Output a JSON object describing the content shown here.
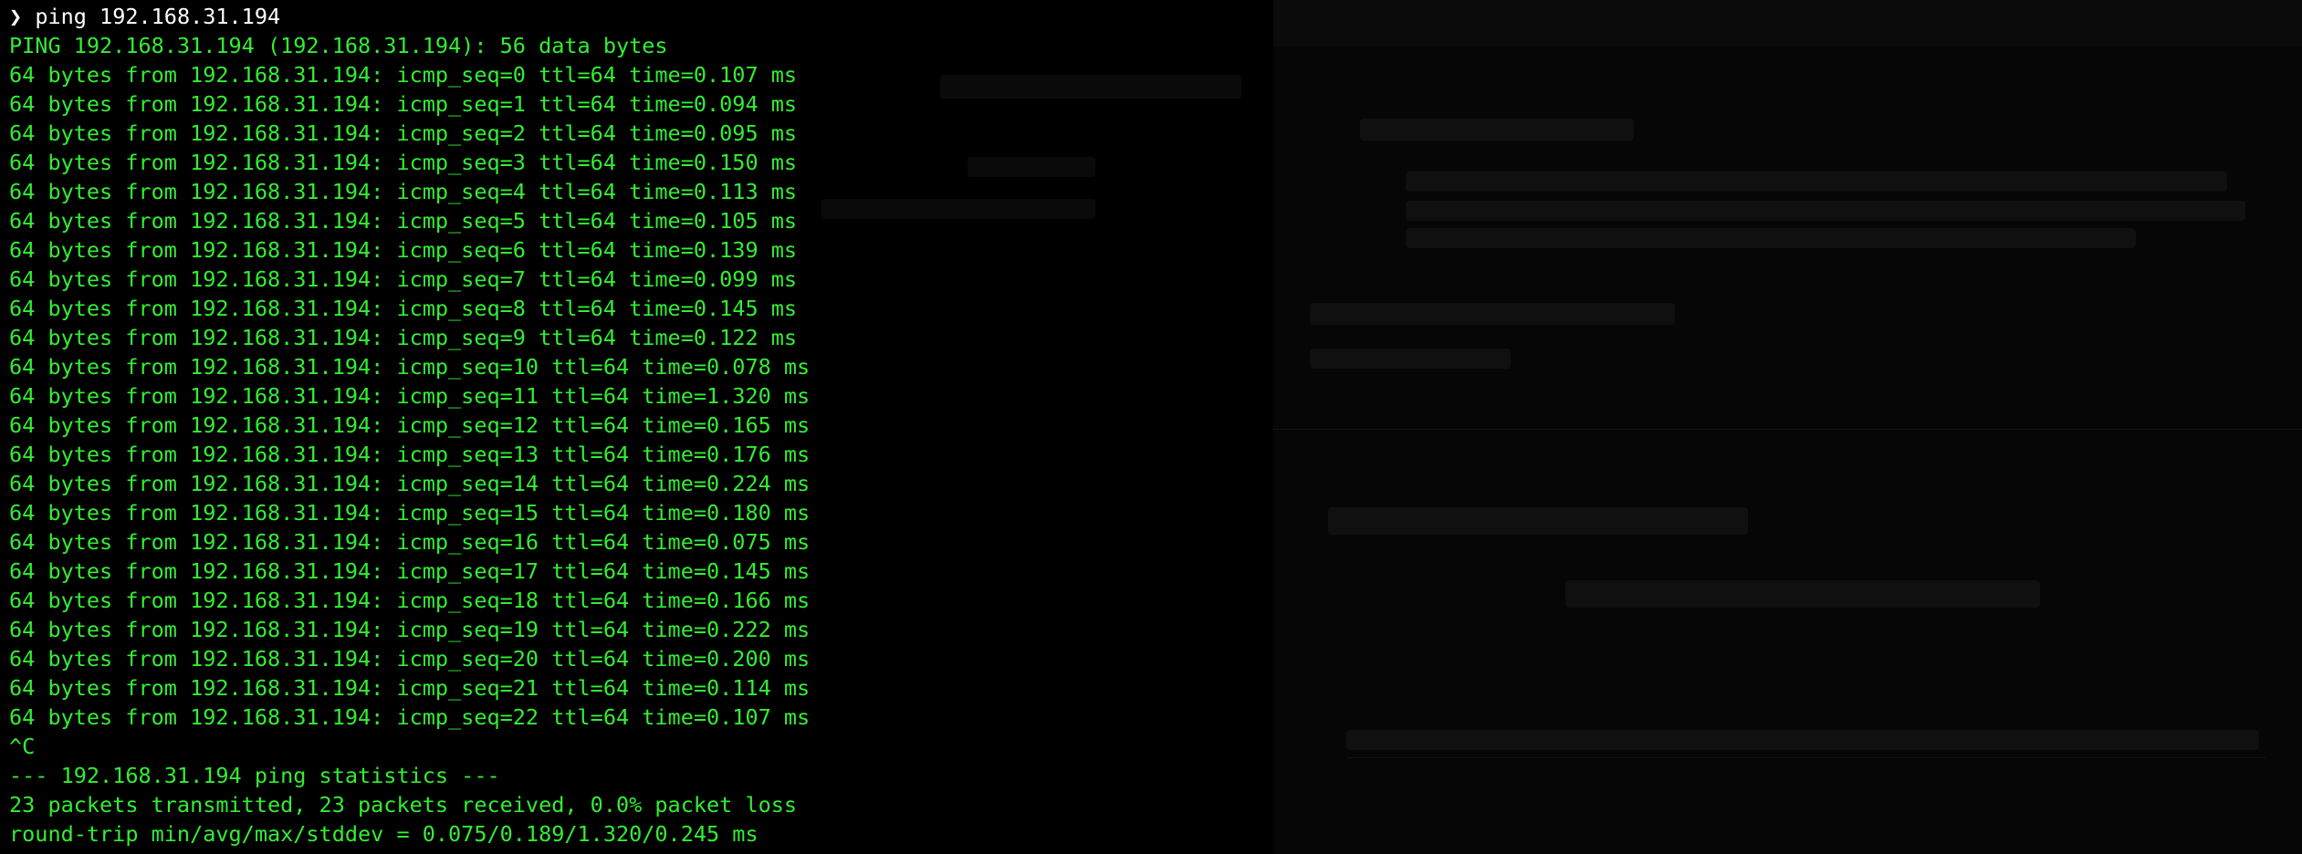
{
  "terminal": {
    "prompt_symbol": "❯",
    "command": "ping 192.168.31.194",
    "text_color": "#33ee33",
    "prompt_color": "#ffffff",
    "background": "#000000",
    "lines": [
      "PING 192.168.31.194 (192.168.31.194): 56 data bytes",
      "64 bytes from 192.168.31.194: icmp_seq=0 ttl=64 time=0.107 ms",
      "64 bytes from 192.168.31.194: icmp_seq=1 ttl=64 time=0.094 ms",
      "64 bytes from 192.168.31.194: icmp_seq=2 ttl=64 time=0.095 ms",
      "64 bytes from 192.168.31.194: icmp_seq=3 ttl=64 time=0.150 ms",
      "64 bytes from 192.168.31.194: icmp_seq=4 ttl=64 time=0.113 ms",
      "64 bytes from 192.168.31.194: icmp_seq=5 ttl=64 time=0.105 ms",
      "64 bytes from 192.168.31.194: icmp_seq=6 ttl=64 time=0.139 ms",
      "64 bytes from 192.168.31.194: icmp_seq=7 ttl=64 time=0.099 ms",
      "64 bytes from 192.168.31.194: icmp_seq=8 ttl=64 time=0.145 ms",
      "64 bytes from 192.168.31.194: icmp_seq=9 ttl=64 time=0.122 ms",
      "64 bytes from 192.168.31.194: icmp_seq=10 ttl=64 time=0.078 ms",
      "64 bytes from 192.168.31.194: icmp_seq=11 ttl=64 time=1.320 ms",
      "64 bytes from 192.168.31.194: icmp_seq=12 ttl=64 time=0.165 ms",
      "64 bytes from 192.168.31.194: icmp_seq=13 ttl=64 time=0.176 ms",
      "64 bytes from 192.168.31.194: icmp_seq=14 ttl=64 time=0.224 ms",
      "64 bytes from 192.168.31.194: icmp_seq=15 ttl=64 time=0.180 ms",
      "64 bytes from 192.168.31.194: icmp_seq=16 ttl=64 time=0.075 ms",
      "64 bytes from 192.168.31.194: icmp_seq=17 ttl=64 time=0.145 ms",
      "64 bytes from 192.168.31.194: icmp_seq=18 ttl=64 time=0.166 ms",
      "64 bytes from 192.168.31.194: icmp_seq=19 ttl=64 time=0.222 ms",
      "64 bytes from 192.168.31.194: icmp_seq=20 ttl=64 time=0.200 ms",
      "64 bytes from 192.168.31.194: icmp_seq=21 ttl=64 time=0.114 ms",
      "64 bytes from 192.168.31.194: icmp_seq=22 ttl=64 time=0.107 ms",
      "^C",
      "--- 192.168.31.194 ping statistics ---",
      "23 packets transmitted, 23 packets received, 0.0% packet loss",
      "round-trip min/avg/max/stddev = 0.075/0.189/1.320/0.245 ms"
    ]
  }
}
